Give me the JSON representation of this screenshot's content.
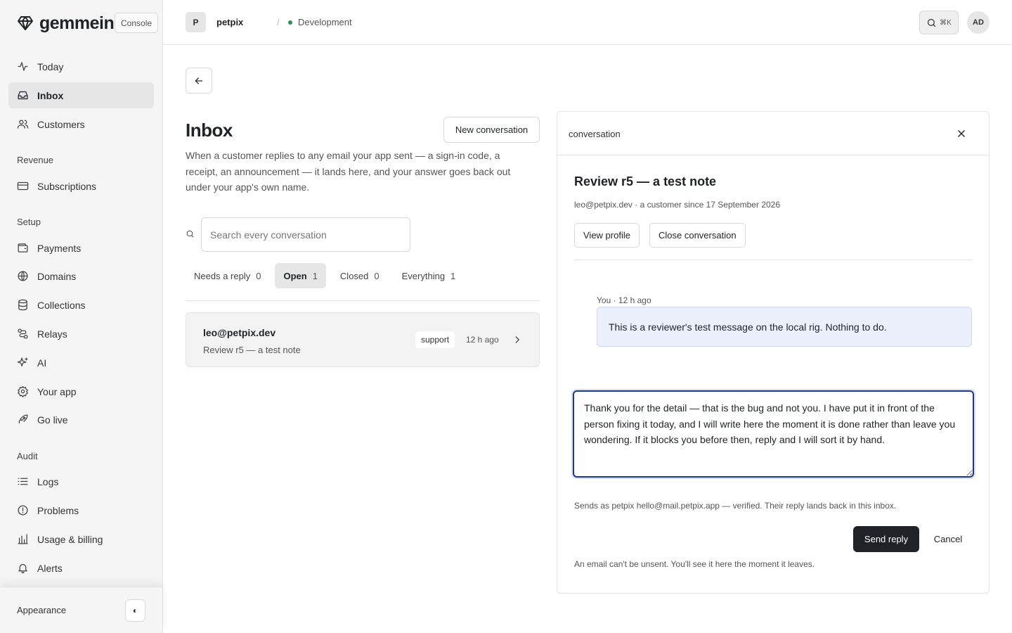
{
  "brand": {
    "name": "gemmein",
    "badge": "Console"
  },
  "nav": {
    "primary": [
      {
        "label": "Today",
        "icon": "activity-icon"
      },
      {
        "label": "Inbox",
        "icon": "inbox-icon",
        "active": true
      },
      {
        "label": "Customers",
        "icon": "users-icon"
      }
    ],
    "revenue": {
      "heading": "Revenue",
      "items": [
        {
          "label": "Subscriptions",
          "icon": "credit-card-icon"
        }
      ]
    },
    "setup": {
      "heading": "Setup",
      "items": [
        {
          "label": "Payments",
          "icon": "wallet-icon"
        },
        {
          "label": "Domains",
          "icon": "globe-icon"
        },
        {
          "label": "Collections",
          "icon": "database-icon"
        },
        {
          "label": "Relays",
          "icon": "route-icon"
        },
        {
          "label": "AI",
          "icon": "sparkles-icon"
        },
        {
          "label": "Your app",
          "icon": "settings-icon"
        },
        {
          "label": "Go live",
          "icon": "rocket-icon"
        }
      ]
    },
    "audit": {
      "heading": "Audit",
      "items": [
        {
          "label": "Logs",
          "icon": "list-icon"
        },
        {
          "label": "Problems",
          "icon": "alert-circle-icon"
        },
        {
          "label": "Usage & billing",
          "icon": "bar-chart-icon"
        },
        {
          "label": "Alerts",
          "icon": "bell-icon"
        }
      ]
    },
    "appearance": {
      "label": "Appearance",
      "toggle": "◐"
    }
  },
  "topbar": {
    "project_initial": "P",
    "project_name": "petpix",
    "separator": "/",
    "environment": "Development",
    "env_color": "#2f8f5b",
    "search_shortcut": "⌘K",
    "user_initials": "AD"
  },
  "inbox": {
    "title": "Inbox",
    "new_button": "New conversation",
    "description": "When a customer replies to any email your app sent — a sign-in code, a receipt, an announcement — it lands here, and your answer goes back out under your app's own name.",
    "search_placeholder": "Search every conversation",
    "tabs": [
      {
        "label": "Needs a reply",
        "count": "0"
      },
      {
        "label": "Open",
        "count": "1",
        "active": true
      },
      {
        "label": "Closed",
        "count": "0"
      },
      {
        "label": "Everything",
        "count": "1"
      }
    ],
    "conversations": [
      {
        "email": "leo@petpix.dev",
        "subject": "Review r5 — a test note",
        "tag": "support",
        "time": "12 h ago"
      }
    ]
  },
  "panel": {
    "label": "conversation",
    "title": "Review r5 — a test note",
    "meta": "leo@petpix.dev · a customer since 17 September 2026",
    "view_profile": "View profile",
    "close_conversation": "Close conversation",
    "message": {
      "meta": "You · 12 h ago",
      "text": "This is a reviewer's test message on the local rig. Nothing to do."
    },
    "reply_text": "Thank you for the detail — that is the bug and not you. I have put it in front of the person fixing it today, and I will write here the moment it is done rather than leave you wondering. If it blocks you before then, reply and I will sort it by hand.",
    "send_note": "Sends as petpix hello@mail.petpix.app — verified. Their reply lands back in this inbox.",
    "send_button": "Send reply",
    "cancel_button": "Cancel",
    "unsend_note": "An email can't be unsent. You'll see it here the moment it leaves."
  }
}
